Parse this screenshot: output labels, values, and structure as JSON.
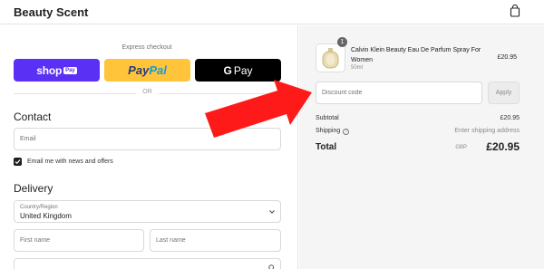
{
  "header": {
    "store_name": "Beauty Scent",
    "cart_icon": "shopping-bag-icon"
  },
  "checkout": {
    "express_label": "Express checkout",
    "shop_pay": {
      "text": "shop",
      "badge": "Pay",
      "color": "#5a31f4"
    },
    "paypal": {
      "part1": "Pay",
      "part2": "Pal",
      "color": "#ffc439"
    },
    "gpay": {
      "letter": "G",
      "text": "Pay",
      "color": "#000000"
    },
    "or_text": "OR",
    "contact_title": "Contact",
    "email_placeholder": "Email",
    "email_offers_label": "Email me with news and offers",
    "email_offers_checked": true,
    "delivery_title": "Delivery",
    "country_label": "Country/Region",
    "country_value": "United Kingdom",
    "first_name_placeholder": "First name",
    "last_name_placeholder": "Last name"
  },
  "order": {
    "product": {
      "quantity": "1",
      "name": "Calvin Klein Beauty Eau De Parfum Spray For Women",
      "variant": "50ml",
      "price": "£20.95"
    },
    "discount_placeholder": "Discount code",
    "apply_label": "Apply",
    "subtotal_label": "Subtotal",
    "subtotal_value": "£20.95",
    "shipping_label": "Shipping",
    "shipping_value": "Enter shipping address",
    "total_label": "Total",
    "total_currency": "GBP",
    "total_value": "£20.95"
  },
  "annotation": {
    "arrow_color": "#ff0000"
  }
}
